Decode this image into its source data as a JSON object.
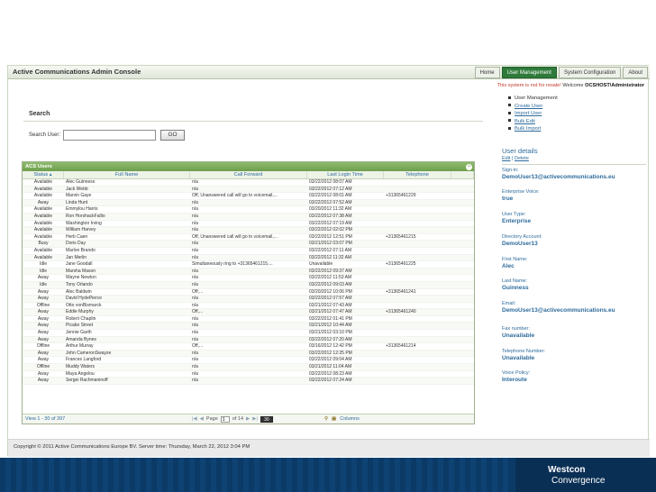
{
  "app": {
    "title": "Active Communications Admin Console",
    "nav": [
      {
        "label": "Home",
        "active": false
      },
      {
        "label": "User Management",
        "active": true
      },
      {
        "label": "System Configuration",
        "active": false
      },
      {
        "label": "About",
        "active": false
      }
    ],
    "status_warning": "This system is not for resale!",
    "status_welcome": " Welcome ",
    "status_user": "OCSHOST\\Administrator"
  },
  "search": {
    "title": "Search",
    "label": "Search User:",
    "value": "",
    "button_label": "GO"
  },
  "grid": {
    "caption": "ACS Users",
    "columns": [
      "Status",
      "Full Name",
      "Call Forward",
      "Last Login Time",
      "Telephone"
    ],
    "sort_indicator": "▴",
    "rows": [
      [
        "Available",
        "Alec Guinness",
        "n/a",
        "03/22/2012 08:07 AM",
        ""
      ],
      [
        "Available",
        "Jack Webb",
        "n/a",
        "03/22/2012 07:12 AM",
        ""
      ],
      [
        "Available",
        "Marvin Gaye",
        "Off, Unanswered call will go to voicemail,...",
        "03/22/2012 08:01 AM",
        "+31365461229"
      ],
      [
        "Away",
        "Linda Hunt",
        "n/a",
        "03/22/2012 07:52 AM",
        ""
      ],
      [
        "Available",
        "Emmylou Harris",
        "n/a",
        "03/20/2012 11:32 AM",
        ""
      ],
      [
        "Available",
        "Ron HorshackFallio",
        "n/a",
        "03/22/2012 07:38 AM",
        ""
      ],
      [
        "Available",
        "Washington Irving",
        "n/a",
        "03/22/2012 07:19 AM",
        ""
      ],
      [
        "Available",
        "William Harvey",
        "n/a",
        "03/22/2012 02:02 PM",
        ""
      ],
      [
        "Available",
        "Herb Caen",
        "Off, Unanswered call will go to voicemail,...",
        "03/22/2012 12:51 PM",
        "+31365461215"
      ],
      [
        "Busy",
        "Doris Day",
        "n/a",
        "03/21/2012 03:07 PM",
        ""
      ],
      [
        "Available",
        "Marlon Brando",
        "n/a",
        "03/22/2012 07:11 AM",
        ""
      ],
      [
        "Available",
        "Jan Merlin",
        "n/a",
        "03/22/2012 11:32 AM",
        ""
      ],
      [
        "Idle",
        "Jane Goodall",
        "Simultaneously ring to +31365461215,...",
        "Unavailable",
        "+31365461225"
      ],
      [
        "Idle",
        "Marsha Mason",
        "n/a",
        "03/22/2012 09:37 AM",
        ""
      ],
      [
        "Away",
        "Wayne Newton",
        "n/a",
        "03/22/2012 11:53 AM",
        ""
      ],
      [
        "Idle",
        "Tony Orlando",
        "n/a",
        "03/22/2012 09:03 AM",
        ""
      ],
      [
        "Away",
        "Alec Baldwin",
        "Off,...",
        "03/20/2012 10:06 PM",
        "+31365461241"
      ],
      [
        "Away",
        "David HydePierce",
        "n/a",
        "03/22/2012 07:57 AM",
        ""
      ],
      [
        "Offline",
        "Otto vonBismarck",
        "n/a",
        "03/21/2012 07:43 AM",
        ""
      ],
      [
        "Away",
        "Eddie Murphy",
        "Off,...",
        "03/21/2012 07:47 AM",
        "+31365461240"
      ],
      [
        "Away",
        "Robert Chaplin",
        "n/a",
        "03/22/2012 01:41 PM",
        ""
      ],
      [
        "Away",
        "Picabo Street",
        "n/a",
        "03/21/2012 10:44 AM",
        ""
      ],
      [
        "Away",
        "Jennie Garth",
        "n/a",
        "03/21/2012 03:10 PM",
        ""
      ],
      [
        "Away",
        "Amanda Bynes",
        "n/a",
        "03/22/2012 07:20 AM",
        ""
      ],
      [
        "Offline",
        "Arthur Murray",
        "Off,...",
        "03/16/2012 12:42 PM",
        "+31365461214"
      ],
      [
        "Away",
        "John CameronSwayze",
        "n/a",
        "03/22/2012 12:25 PM",
        ""
      ],
      [
        "Away",
        "Frances Langford",
        "n/a",
        "03/22/2012 09:04 AM",
        ""
      ],
      [
        "Offline",
        "Muddy Waters",
        "n/a",
        "03/21/2012 11:04 AM",
        ""
      ],
      [
        "Away",
        "Maya Angelou",
        "n/a",
        "03/22/2012 08:23 AM",
        ""
      ],
      [
        "Away",
        "Sergei Rachmaninoff",
        "n/a",
        "03/22/2012 07:24 AM",
        ""
      ]
    ],
    "pager": {
      "range": "View 1 - 30 of 397",
      "page_label": "Page",
      "page_value": "1",
      "of_label": "of 14",
      "first": "|◀",
      "prev": "◀",
      "next": "▶",
      "last": "▶|",
      "page_size": "30",
      "columns_label": "Columns"
    }
  },
  "user_menu": {
    "root": "User Management",
    "items": [
      "Create User",
      "Import User",
      "Bulk Edit",
      "Bulk Import"
    ]
  },
  "user_details": {
    "title": "User details",
    "edit_label": "Edit",
    "separator": "|",
    "delete_label": "Delete",
    "fields": [
      {
        "label": "Sign-in:",
        "value": "DemoUser13@activecommunications.eu"
      },
      {
        "label": "Enterprise Voice:",
        "value": "true"
      },
      {
        "label": "User Type:",
        "value": "Enterprise"
      },
      {
        "label": "Directory Account:",
        "value": "DemoUser13"
      },
      {
        "label": "First Name:",
        "value": "Alec"
      },
      {
        "label": "Last Name:",
        "value": "Guinness"
      },
      {
        "label": "Email:",
        "value": "DemoUser13@activecommunications.eu"
      },
      {
        "label": "Fax number:",
        "value": "Unavailable"
      },
      {
        "label": "Telephone Number:",
        "value": "Unavailable"
      },
      {
        "label": "Voice Policy:",
        "value": "Interoute"
      }
    ]
  },
  "footer": {
    "text": "Copyright © 2011 Active Communications Europe BV. Server time: Thursday, March 22, 2012 3:04 PM"
  },
  "brand": {
    "name": "Westcon",
    "sub": "Convergence"
  }
}
